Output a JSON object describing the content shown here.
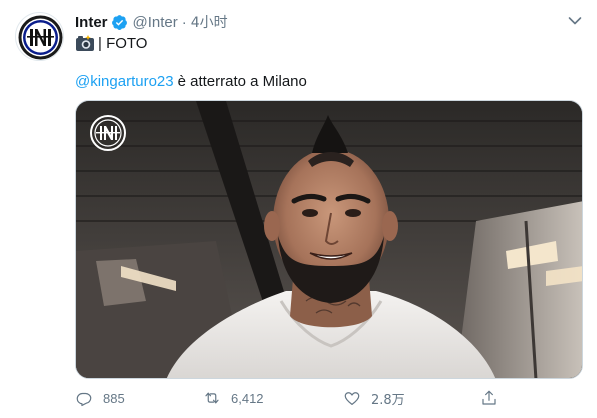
{
  "tweet": {
    "author": {
      "display_name": "Inter",
      "handle": "@Inter",
      "separator": "·",
      "time": "4小时",
      "verified": true,
      "avatar_icon": "inter-logo-icon"
    },
    "text_line1": "| FOTO",
    "text_line1_icon": "camera-icon",
    "mention": "@kingarturo23",
    "text_line2_rest": "è atterrato a Milano",
    "media_icon": "inter-watermark-icon",
    "actions": {
      "reply_count": "885",
      "retweet_count": "6,412",
      "like_count": "2.8万",
      "share_icon": "share-icon"
    }
  },
  "colors": {
    "link": "#1da1f2",
    "secondary_text": "#657786",
    "verified": "#1da1f2",
    "inter_blue": "#0a1d8c"
  }
}
